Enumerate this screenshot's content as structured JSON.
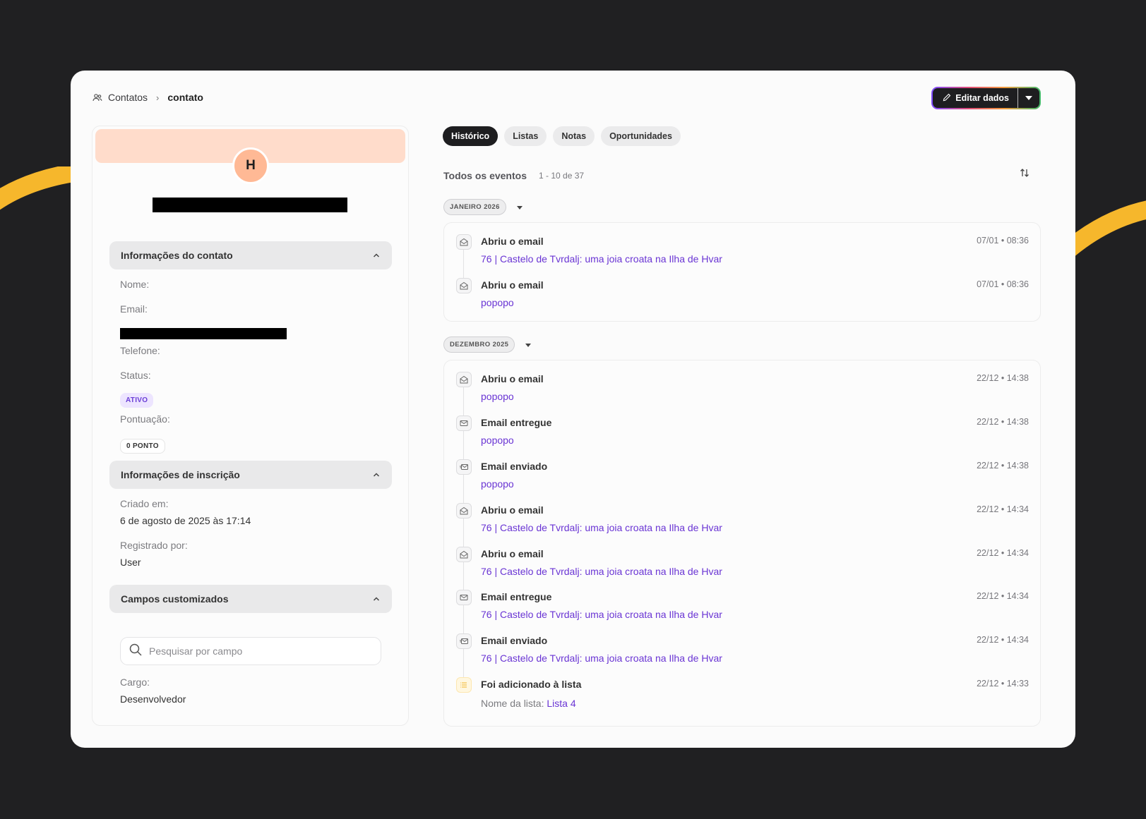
{
  "breadcrumb": {
    "root": "Contatos",
    "current": "contato"
  },
  "actions": {
    "edit_label": "Editar dados"
  },
  "profile": {
    "avatar_initial": "H",
    "contact_section": {
      "title": "Informações do contato",
      "nome_label": "Nome:",
      "email_label": "Email:",
      "telefone_label": "Telefone:",
      "status_label": "Status:",
      "status_value": "ATIVO",
      "pontuacao_label": "Pontuação:",
      "pontuacao_value": "0 PONTO"
    },
    "subscription_section": {
      "title": "Informações de inscrição",
      "criado_label": "Criado em:",
      "criado_value": "6 de agosto de 2025 às 17:14",
      "registrado_label": "Registrado por:",
      "registrado_value": "User"
    },
    "custom_section": {
      "title": "Campos customizados",
      "search_placeholder": "Pesquisar por campo",
      "cargo_label": "Cargo:",
      "cargo_value": "Desenvolvedor"
    }
  },
  "tabs": [
    "Histórico",
    "Listas",
    "Notas",
    "Oportunidades"
  ],
  "events": {
    "title": "Todos os eventos",
    "range": "1 - 10 de 37",
    "groups": [
      {
        "month": "JANEIRO 2026",
        "items": [
          {
            "icon": "email-open-icon",
            "title": "Abriu o email",
            "subtitle": "76 | Castelo de Tvrdalj: uma joia croata na Ilha de Hvar",
            "time": "07/01 • 08:36"
          },
          {
            "icon": "email-open-icon",
            "title": "Abriu o email",
            "subtitle": "popopo",
            "time": "07/01 • 08:36"
          }
        ]
      },
      {
        "month": "DEZEMBRO 2025",
        "items": [
          {
            "icon": "email-open-icon",
            "title": "Abriu o email",
            "subtitle": "popopo",
            "time": "22/12 • 14:38"
          },
          {
            "icon": "mail-icon",
            "title": "Email entregue",
            "subtitle": "popopo",
            "time": "22/12 • 14:38"
          },
          {
            "icon": "mail-send-icon",
            "title": "Email enviado",
            "subtitle": "popopo",
            "time": "22/12 • 14:38"
          },
          {
            "icon": "email-open-icon",
            "title": "Abriu o email",
            "subtitle": "76 | Castelo de Tvrdalj: uma joia croata na Ilha de Hvar",
            "time": "22/12 • 14:34"
          },
          {
            "icon": "email-open-icon",
            "title": "Abriu o email",
            "subtitle": "76 | Castelo de Tvrdalj: uma joia croata na Ilha de Hvar",
            "time": "22/12 • 14:34"
          },
          {
            "icon": "mail-icon",
            "title": "Email entregue",
            "subtitle": "76 | Castelo de Tvrdalj: uma joia croata na Ilha de Hvar",
            "time": "22/12 • 14:34"
          },
          {
            "icon": "mail-send-icon",
            "title": "Email enviado",
            "subtitle": "76 | Castelo de Tvrdalj: uma joia croata na Ilha de Hvar",
            "time": "22/12 • 14:34"
          },
          {
            "icon": "list-icon",
            "title": "Foi adicionado à lista",
            "subtitle_label": "Nome da lista:",
            "subtitle": "Lista 4",
            "time": "22/12 • 14:33"
          }
        ]
      }
    ]
  },
  "colors": {
    "accent": "#6a35d4",
    "banner": "#ffdccb",
    "avatar": "#ffb995",
    "stripe": "#f6b72c"
  }
}
